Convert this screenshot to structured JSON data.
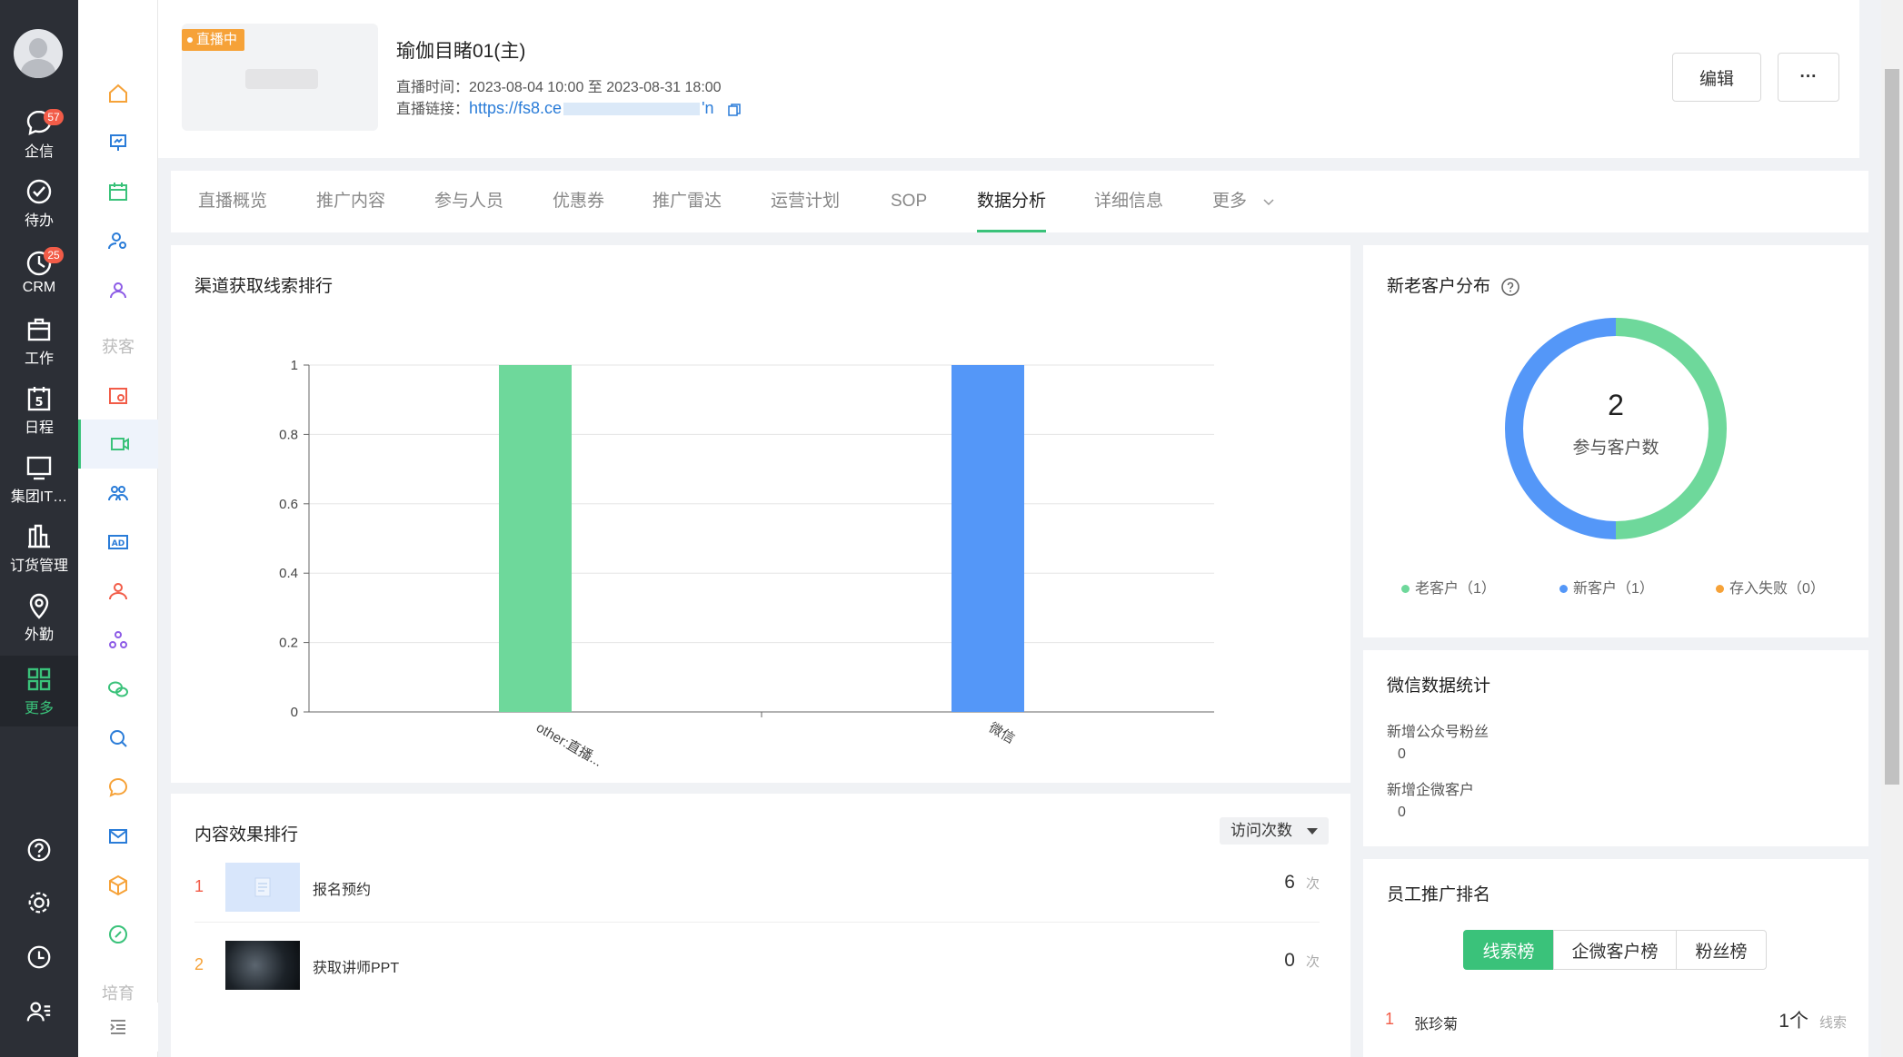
{
  "nav": {
    "items": [
      {
        "label": "企信",
        "badge": "57",
        "icon": "chat-bubble-icon"
      },
      {
        "label": "待办",
        "badge": "",
        "icon": "check-circle-icon"
      },
      {
        "label": "CRM",
        "badge": "25",
        "icon": "pie-clock-icon"
      },
      {
        "label": "工作",
        "badge": "",
        "icon": "briefcase-icon"
      },
      {
        "label": "日程",
        "badge": "",
        "icon": "calendar-5-icon"
      },
      {
        "label": "集团IT…",
        "badge": "",
        "icon": "monitor-icon"
      },
      {
        "label": "订货管理",
        "badge": "",
        "icon": "chart-bars-icon"
      },
      {
        "label": "外勤",
        "badge": "",
        "icon": "location-pin-icon"
      },
      {
        "label": "更多",
        "badge": "",
        "icon": "grid-icon"
      }
    ]
  },
  "subnav": {
    "section_label": "获客",
    "section_label_2": "培育"
  },
  "header": {
    "live_badge": "直播中",
    "title": "瑜伽目睹01(主)",
    "time_label": "直播时间：",
    "time_value": "2023-08-04 10:00 至 2023-08-31 18:00",
    "link_label": "直播链接：",
    "link_start": "https://fs8.ce",
    "link_end": "'n",
    "edit_button": "编辑",
    "more_button": "···"
  },
  "tabs": [
    "直播概览",
    "推广内容",
    "参与人员",
    "优惠券",
    "推广雷达",
    "运营计划",
    "SOP",
    "数据分析",
    "详细信息",
    "更多"
  ],
  "channel_card": {
    "title": "渠道获取线索排行"
  },
  "chart_data": {
    "type": "bar",
    "categories": [
      "other:直播...",
      "微信"
    ],
    "values": [
      1,
      1
    ],
    "colors": [
      "#6ed89b",
      "#5497f8"
    ],
    "ylim": [
      0,
      1
    ],
    "yticks": [
      "0",
      "0.2",
      "0.4",
      "0.6",
      "0.8",
      "1"
    ],
    "title": "",
    "xlabel": "",
    "ylabel": ""
  },
  "customer_card": {
    "title": "新老客户分布",
    "center_value": "2",
    "center_label": "参与客户数",
    "segments": [
      {
        "label": "老客户（1）",
        "value": 1,
        "color": "#6ed89b"
      },
      {
        "label": "新客户（1）",
        "value": 1,
        "color": "#5497f8"
      },
      {
        "label": "存入失败（0）",
        "value": 0,
        "color": "#f6a238"
      }
    ]
  },
  "content_card": {
    "title": "内容效果排行",
    "sort_select": "访问次数",
    "unit": "次",
    "rows": [
      {
        "rank": "1",
        "name": "报名预约",
        "count": "6"
      },
      {
        "rank": "2",
        "name": "获取讲师PPT",
        "count": "0"
      }
    ]
  },
  "wechat_card": {
    "title": "微信数据统计",
    "stats": [
      {
        "label": "新增公众号粉丝",
        "value": "0"
      },
      {
        "label": "新增企微客户",
        "value": "0"
      }
    ]
  },
  "staff_card": {
    "title": "员工推广排名",
    "segments": [
      "线索榜",
      "企微客户榜",
      "粉丝榜"
    ],
    "rows": [
      {
        "rank": "1",
        "name": "张珍菊",
        "count": "1个",
        "unit": "线索"
      }
    ]
  }
}
